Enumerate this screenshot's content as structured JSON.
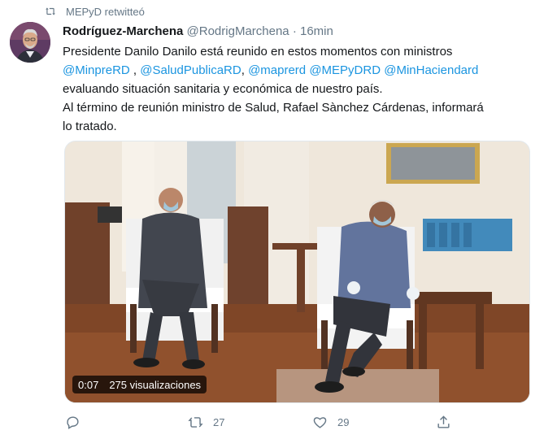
{
  "retweet_bar": {
    "text": "MEPyD retwitteó"
  },
  "author": {
    "name": "Rodríguez-Marchena",
    "handle": "@RodrigMarchena",
    "separator": "·",
    "time": "16min"
  },
  "body": {
    "line1": "Presidente Danilo Danilo está reunido en estos momentos con  ministros",
    "mentions": [
      "@MinpreRD",
      "@SaludPublicaRD",
      "@maprerd",
      "@MEPyDRD",
      "@MinHaciendard"
    ],
    "mention_separator": " , ",
    "line3": "evaluando situación sanitaria y económica de nuestro país.",
    "line4": "Al término de reunión ministro de Salud, Rafael Sànchez Cárdenas, informará",
    "line5": "lo tratado."
  },
  "video": {
    "elapsed": "0:07",
    "views": "275 visualizaciones"
  },
  "actions": {
    "reply_count": "",
    "retweet_count": "27",
    "like_count": "29"
  },
  "icons": {
    "retweet": "retweet-icon",
    "reply": "reply-icon",
    "like": "heart-icon",
    "share": "share-icon"
  },
  "colors": {
    "link": "#1b95e0",
    "secondary": "#657786",
    "text": "#14171a"
  }
}
